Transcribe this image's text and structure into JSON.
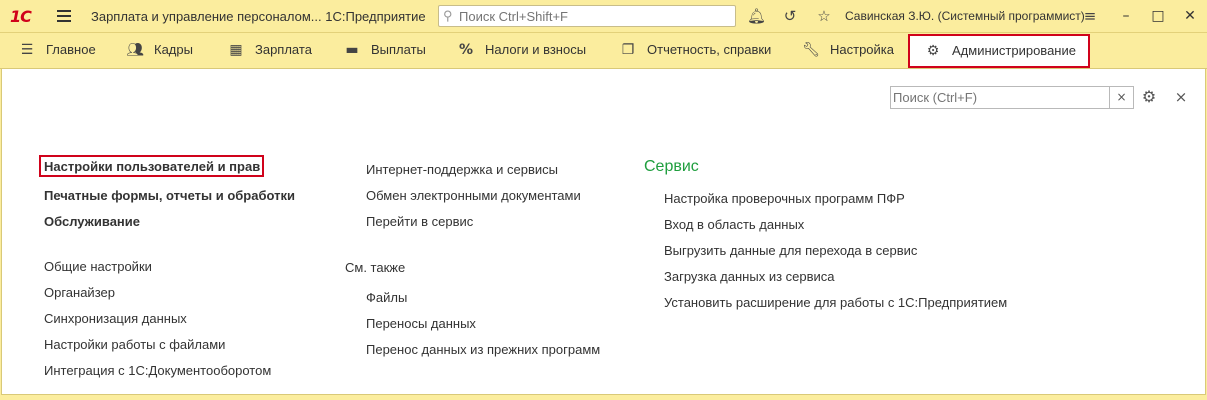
{
  "titlebar": {
    "logo": "1С",
    "title": "Зарплата и управление персоналом... 1С:Предприятие",
    "search_placeholder": "Поиск Ctrl+Shift+F",
    "user": "Савинская З.Ю. (Системный программист)",
    "icons": [
      "bell-icon",
      "history-icon",
      "star-icon",
      "menu-lines-icon"
    ],
    "window_buttons": [
      "minimize",
      "maximize",
      "close"
    ]
  },
  "menu": [
    {
      "label": "Главное",
      "icon": "menu-icon"
    },
    {
      "label": "Кадры",
      "icon": "people-icon"
    },
    {
      "label": "Зарплата",
      "icon": "calculator-icon"
    },
    {
      "label": "Выплаты",
      "icon": "wallet-icon"
    },
    {
      "label": "Налоги и взносы",
      "icon": "percent-icon"
    },
    {
      "label": "Отчетность, справки",
      "icon": "documents-icon"
    },
    {
      "label": "Настройка",
      "icon": "wrench-icon"
    },
    {
      "label": "Администрирование",
      "icon": "gear-icon",
      "active": true
    }
  ],
  "panel": {
    "search_placeholder": "Поиск (Ctrl+F)",
    "clear": "×",
    "close": "×"
  },
  "col1": {
    "bold_links": [
      "Настройки пользователей и прав",
      "Печатные формы, отчеты и обработки",
      "Обслуживание"
    ],
    "links": [
      "Общие настройки",
      "Органайзер",
      "Синхронизация данных",
      "Настройки работы с файлами",
      "Интеграция с 1С:Документооборотом"
    ]
  },
  "col2": {
    "links": [
      "Интернет-поддержка и сервисы",
      "Обмен электронными документами",
      "Перейти в сервис"
    ],
    "see_also": "См. также",
    "see_also_links": [
      "Файлы",
      "Переносы данных",
      "Перенос данных из прежних программ"
    ]
  },
  "col3": {
    "heading": "Сервис",
    "links": [
      "Настройка проверочных программ ПФР",
      "Вход в область данных",
      "Выгрузить данные для перехода в сервис",
      "Загрузка данных из сервиса",
      "Установить расширение для работы с 1С:Предприятием"
    ]
  },
  "colors": {
    "accent_bg": "#fbed9e",
    "highlight_border": "#d0021b",
    "service_heading": "#1f9e3e"
  }
}
